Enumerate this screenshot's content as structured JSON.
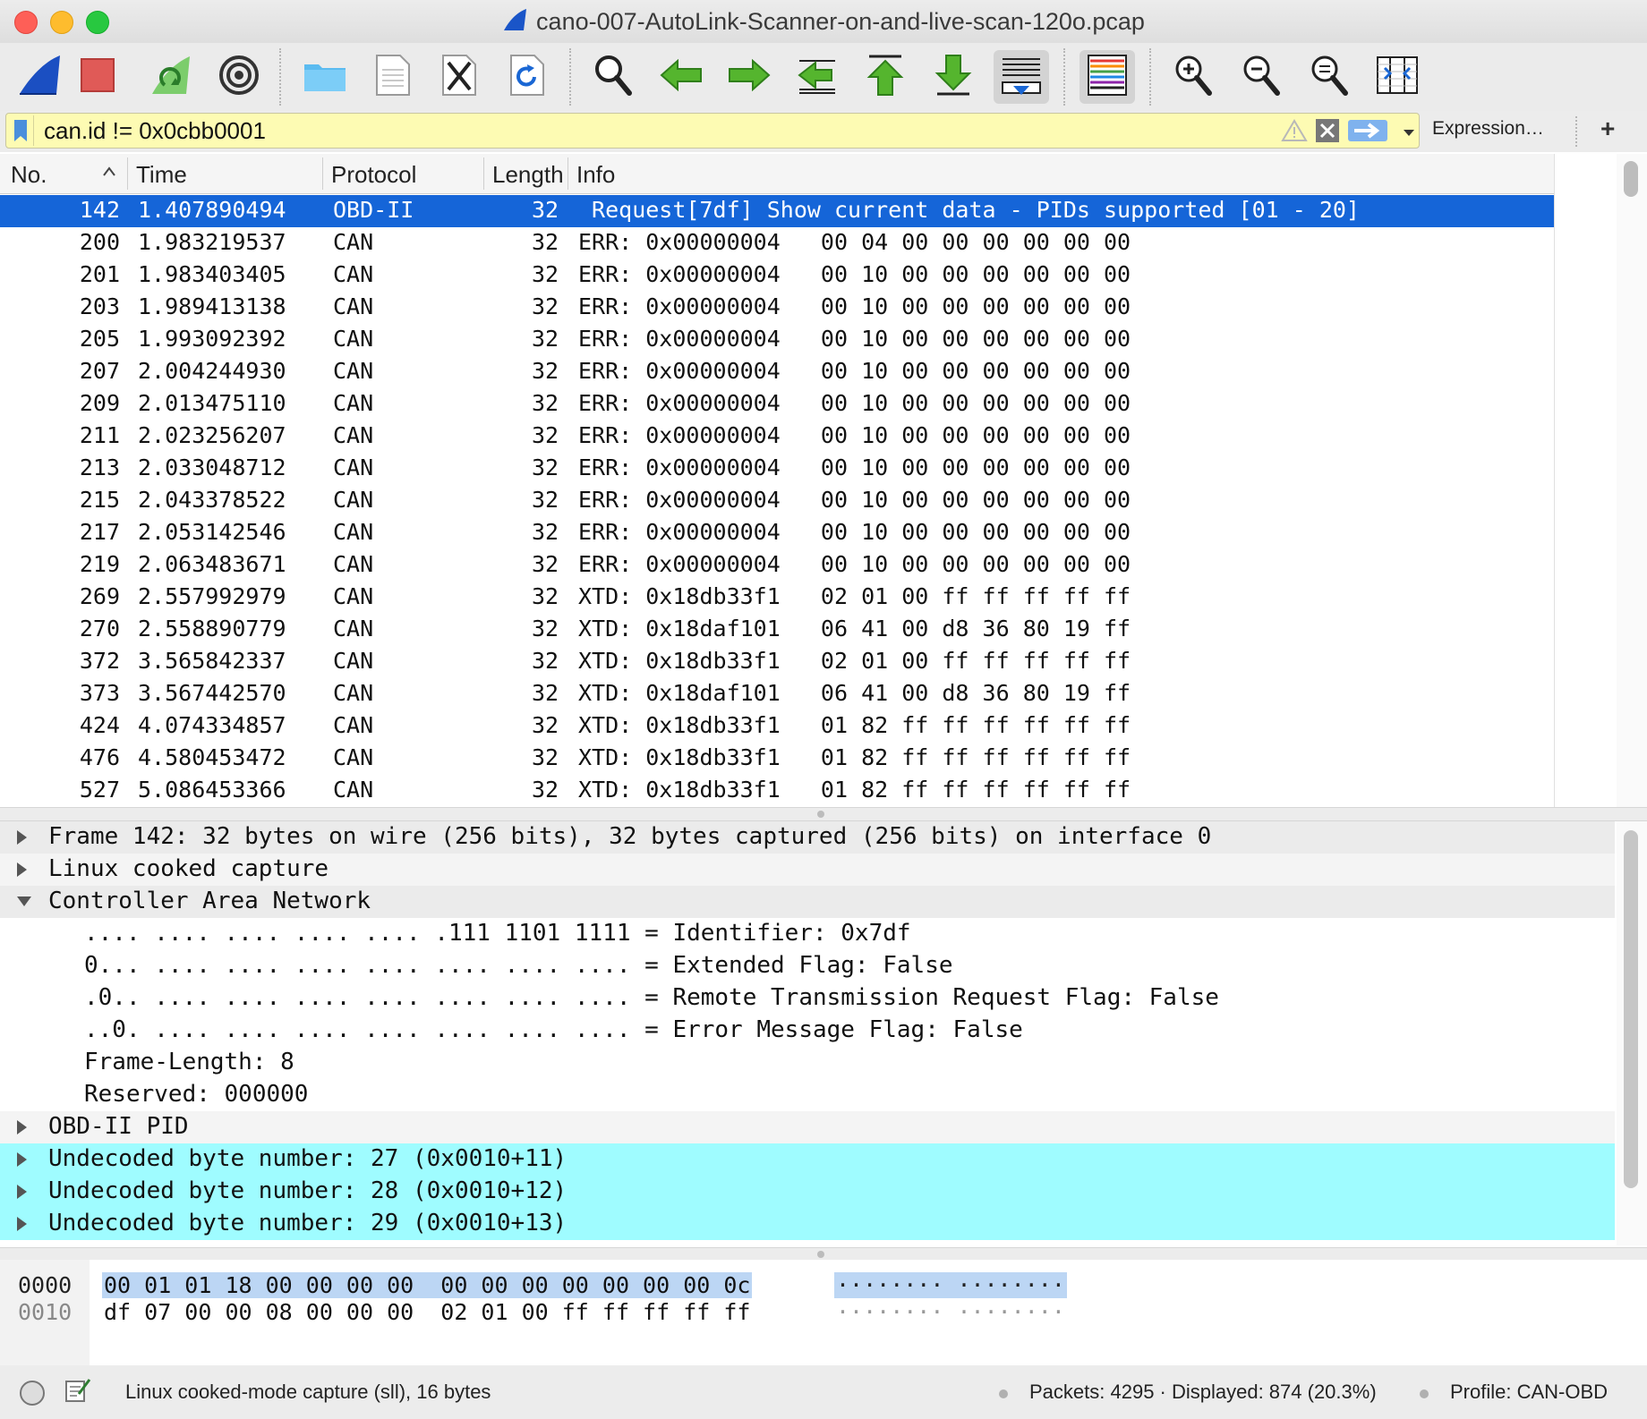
{
  "window": {
    "title": "cano-007-AutoLink-Scanner-on-and-live-scan-120o.pcap"
  },
  "toolbar": {
    "buttons": [
      "start-capture",
      "stop-capture",
      "restart-capture",
      "capture-options",
      "open-file",
      "save-file",
      "close-file",
      "reload-file",
      "find-packet",
      "go-back",
      "go-forward",
      "go-to-packet",
      "go-first",
      "go-last",
      "auto-scroll",
      "colorize",
      "zoom-in",
      "zoom-out",
      "zoom-normal",
      "resize-columns"
    ]
  },
  "filter": {
    "value": "can.id != 0x0cbb0001",
    "expression_label": "Expression…",
    "add_label": "+"
  },
  "packet_list": {
    "columns": [
      "No.",
      "Time",
      "Protocol",
      "Length",
      "Info"
    ],
    "rows": [
      {
        "no": "142",
        "time": "1.407890494",
        "proto": "OBD-II",
        "len": "32",
        "info": " Request[7df] Show current data - PIDs supported [01 - 20]",
        "selected": true
      },
      {
        "no": "200",
        "time": "1.983219537",
        "proto": "CAN",
        "len": "32",
        "info": "ERR: 0x00000004   00 04 00 00 00 00 00 00"
      },
      {
        "no": "201",
        "time": "1.983403405",
        "proto": "CAN",
        "len": "32",
        "info": "ERR: 0x00000004   00 10 00 00 00 00 00 00"
      },
      {
        "no": "203",
        "time": "1.989413138",
        "proto": "CAN",
        "len": "32",
        "info": "ERR: 0x00000004   00 10 00 00 00 00 00 00"
      },
      {
        "no": "205",
        "time": "1.993092392",
        "proto": "CAN",
        "len": "32",
        "info": "ERR: 0x00000004   00 10 00 00 00 00 00 00"
      },
      {
        "no": "207",
        "time": "2.004244930",
        "proto": "CAN",
        "len": "32",
        "info": "ERR: 0x00000004   00 10 00 00 00 00 00 00"
      },
      {
        "no": "209",
        "time": "2.013475110",
        "proto": "CAN",
        "len": "32",
        "info": "ERR: 0x00000004   00 10 00 00 00 00 00 00"
      },
      {
        "no": "211",
        "time": "2.023256207",
        "proto": "CAN",
        "len": "32",
        "info": "ERR: 0x00000004   00 10 00 00 00 00 00 00"
      },
      {
        "no": "213",
        "time": "2.033048712",
        "proto": "CAN",
        "len": "32",
        "info": "ERR: 0x00000004   00 10 00 00 00 00 00 00"
      },
      {
        "no": "215",
        "time": "2.043378522",
        "proto": "CAN",
        "len": "32",
        "info": "ERR: 0x00000004   00 10 00 00 00 00 00 00"
      },
      {
        "no": "217",
        "time": "2.053142546",
        "proto": "CAN",
        "len": "32",
        "info": "ERR: 0x00000004   00 10 00 00 00 00 00 00"
      },
      {
        "no": "219",
        "time": "2.063483671",
        "proto": "CAN",
        "len": "32",
        "info": "ERR: 0x00000004   00 10 00 00 00 00 00 00"
      },
      {
        "no": "269",
        "time": "2.557992979",
        "proto": "CAN",
        "len": "32",
        "info": "XTD: 0x18db33f1   02 01 00 ff ff ff ff ff"
      },
      {
        "no": "270",
        "time": "2.558890779",
        "proto": "CAN",
        "len": "32",
        "info": "XTD: 0x18daf101   06 41 00 d8 36 80 19 ff"
      },
      {
        "no": "372",
        "time": "3.565842337",
        "proto": "CAN",
        "len": "32",
        "info": "XTD: 0x18db33f1   02 01 00 ff ff ff ff ff"
      },
      {
        "no": "373",
        "time": "3.567442570",
        "proto": "CAN",
        "len": "32",
        "info": "XTD: 0x18daf101   06 41 00 d8 36 80 19 ff"
      },
      {
        "no": "424",
        "time": "4.074334857",
        "proto": "CAN",
        "len": "32",
        "info": "XTD: 0x18db33f1   01 82 ff ff ff ff ff ff"
      },
      {
        "no": "476",
        "time": "4.580453472",
        "proto": "CAN",
        "len": "32",
        "info": "XTD: 0x18db33f1   01 82 ff ff ff ff ff ff"
      },
      {
        "no": "527",
        "time": "5.086453366",
        "proto": "CAN",
        "len": "32",
        "info": "XTD: 0x18db33f1   01 82 ff ff ff ff ff ff"
      }
    ]
  },
  "details": {
    "rows": [
      {
        "text": "Frame 142: 32 bytes on wire (256 bits), 32 bytes captured (256 bits) on interface 0",
        "level": 0,
        "expander": "collapsed",
        "style": "top"
      },
      {
        "text": "Linux cooked capture",
        "level": 0,
        "expander": "collapsed",
        "style": "top-alt"
      },
      {
        "text": "Controller Area Network",
        "level": 0,
        "expander": "expanded",
        "style": "top"
      },
      {
        "text": ".... .... .... .... .... .111 1101 1111 = Identifier: 0x7df",
        "level": 1,
        "expander": "none",
        "style": "plain"
      },
      {
        "text": "0... .... .... .... .... .... .... .... = Extended Flag: False",
        "level": 1,
        "expander": "none",
        "style": "plain"
      },
      {
        "text": ".0.. .... .... .... .... .... .... .... = Remote Transmission Request Flag: False",
        "level": 1,
        "expander": "none",
        "style": "plain"
      },
      {
        "text": "..0. .... .... .... .... .... .... .... = Error Message Flag: False",
        "level": 1,
        "expander": "none",
        "style": "plain"
      },
      {
        "text": "Frame-Length: 8",
        "level": 1,
        "expander": "none",
        "style": "plain"
      },
      {
        "text": "Reserved: 000000",
        "level": 1,
        "expander": "none",
        "style": "plain"
      },
      {
        "text": "OBD-II PID",
        "level": 0,
        "expander": "collapsed",
        "style": "top-alt"
      },
      {
        "text": "Undecoded byte number: 27 (0x0010+11)",
        "level": 0,
        "expander": "collapsed",
        "style": "hl"
      },
      {
        "text": "Undecoded byte number: 28 (0x0010+12)",
        "level": 0,
        "expander": "collapsed",
        "style": "hl"
      },
      {
        "text": "Undecoded byte number: 29 (0x0010+13)",
        "level": 0,
        "expander": "collapsed",
        "style": "hl"
      }
    ]
  },
  "bytes": {
    "rows": [
      {
        "offset": "0000",
        "hex": "00 01 01 18 00 00 00 00  00 00 00 00 00 00 00 0c",
        "ascii": "········ ········",
        "selected": true
      },
      {
        "offset": "0010",
        "hex": "df 07 00 00 08 00 00 00  02 01 00 ff ff ff ff ff",
        "ascii": "········ ········",
        "selected": false
      }
    ]
  },
  "status": {
    "left_text": "Linux cooked-mode capture (sll), 16 bytes",
    "packets_text": "Packets: 4295 · Displayed: 874 (20.3%)",
    "profile_text": "Profile: CAN-OBD"
  },
  "colors": {
    "selection": "#1565d8",
    "filter_bg": "#fdfbb3",
    "highlight_row": "#9ffcff",
    "bytes_selection": "#bcd6f4"
  }
}
